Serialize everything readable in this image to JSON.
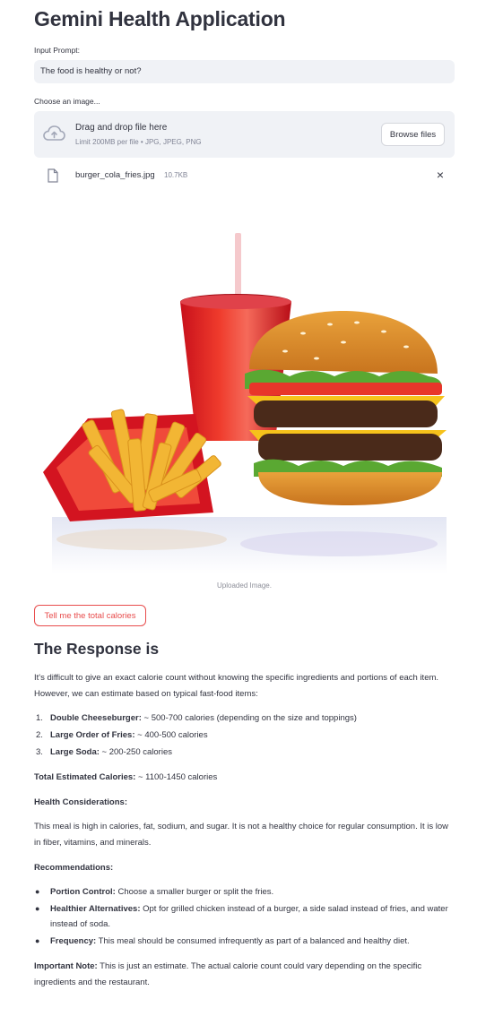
{
  "app": {
    "title": "Gemini Health Application"
  },
  "input": {
    "label": "Input Prompt:",
    "value": "The food is healthy or not?"
  },
  "uploader": {
    "label": "Choose an image...",
    "drop_title": "Drag and drop file here",
    "limit": "Limit 200MB per file • JPG, JPEG, PNG",
    "browse_label": "Browse files"
  },
  "file": {
    "name": "burger_cola_fries.jpg",
    "size": "10.7KB",
    "remove": "×"
  },
  "image": {
    "caption": "Uploaded Image."
  },
  "action": {
    "button_label": "Tell me the total calories"
  },
  "response": {
    "heading": "The Response is",
    "intro": "It's difficult to give an exact calorie count without knowing the specific ingredients and portions of each item. However, we can estimate based on typical fast-food items:",
    "items": [
      {
        "num": "1.",
        "label": "Double Cheeseburger:",
        "text": " ~ 500-700 calories (depending on the size and toppings)"
      },
      {
        "num": "2.",
        "label": "Large Order of Fries:",
        "text": " ~ 400-500 calories"
      },
      {
        "num": "3.",
        "label": "Large Soda:",
        "text": " ~ 200-250 calories"
      }
    ],
    "total_label": "Total Estimated Calories:",
    "total_value": " ~ 1100-1450 calories",
    "health_heading": "Health Considerations:",
    "health_text": "This meal is high in calories, fat, sodium, and sugar. It is not a healthy choice for regular consumption. It is low in fiber, vitamins, and minerals.",
    "rec_heading": "Recommendations:",
    "recommendations": [
      {
        "label": "Portion Control:",
        "text": " Choose a smaller burger or split the fries."
      },
      {
        "label": "Healthier Alternatives:",
        "text": " Opt for grilled chicken instead of a burger, a side salad instead of fries, and water instead of soda."
      },
      {
        "label": "Frequency:",
        "text": " This meal should be consumed infrequently as part of a balanced and healthy diet."
      }
    ],
    "note_label": "Important Note:",
    "note_text": " This is just an estimate. The actual calorie count could vary depending on the specific ingredients and the restaurant."
  }
}
